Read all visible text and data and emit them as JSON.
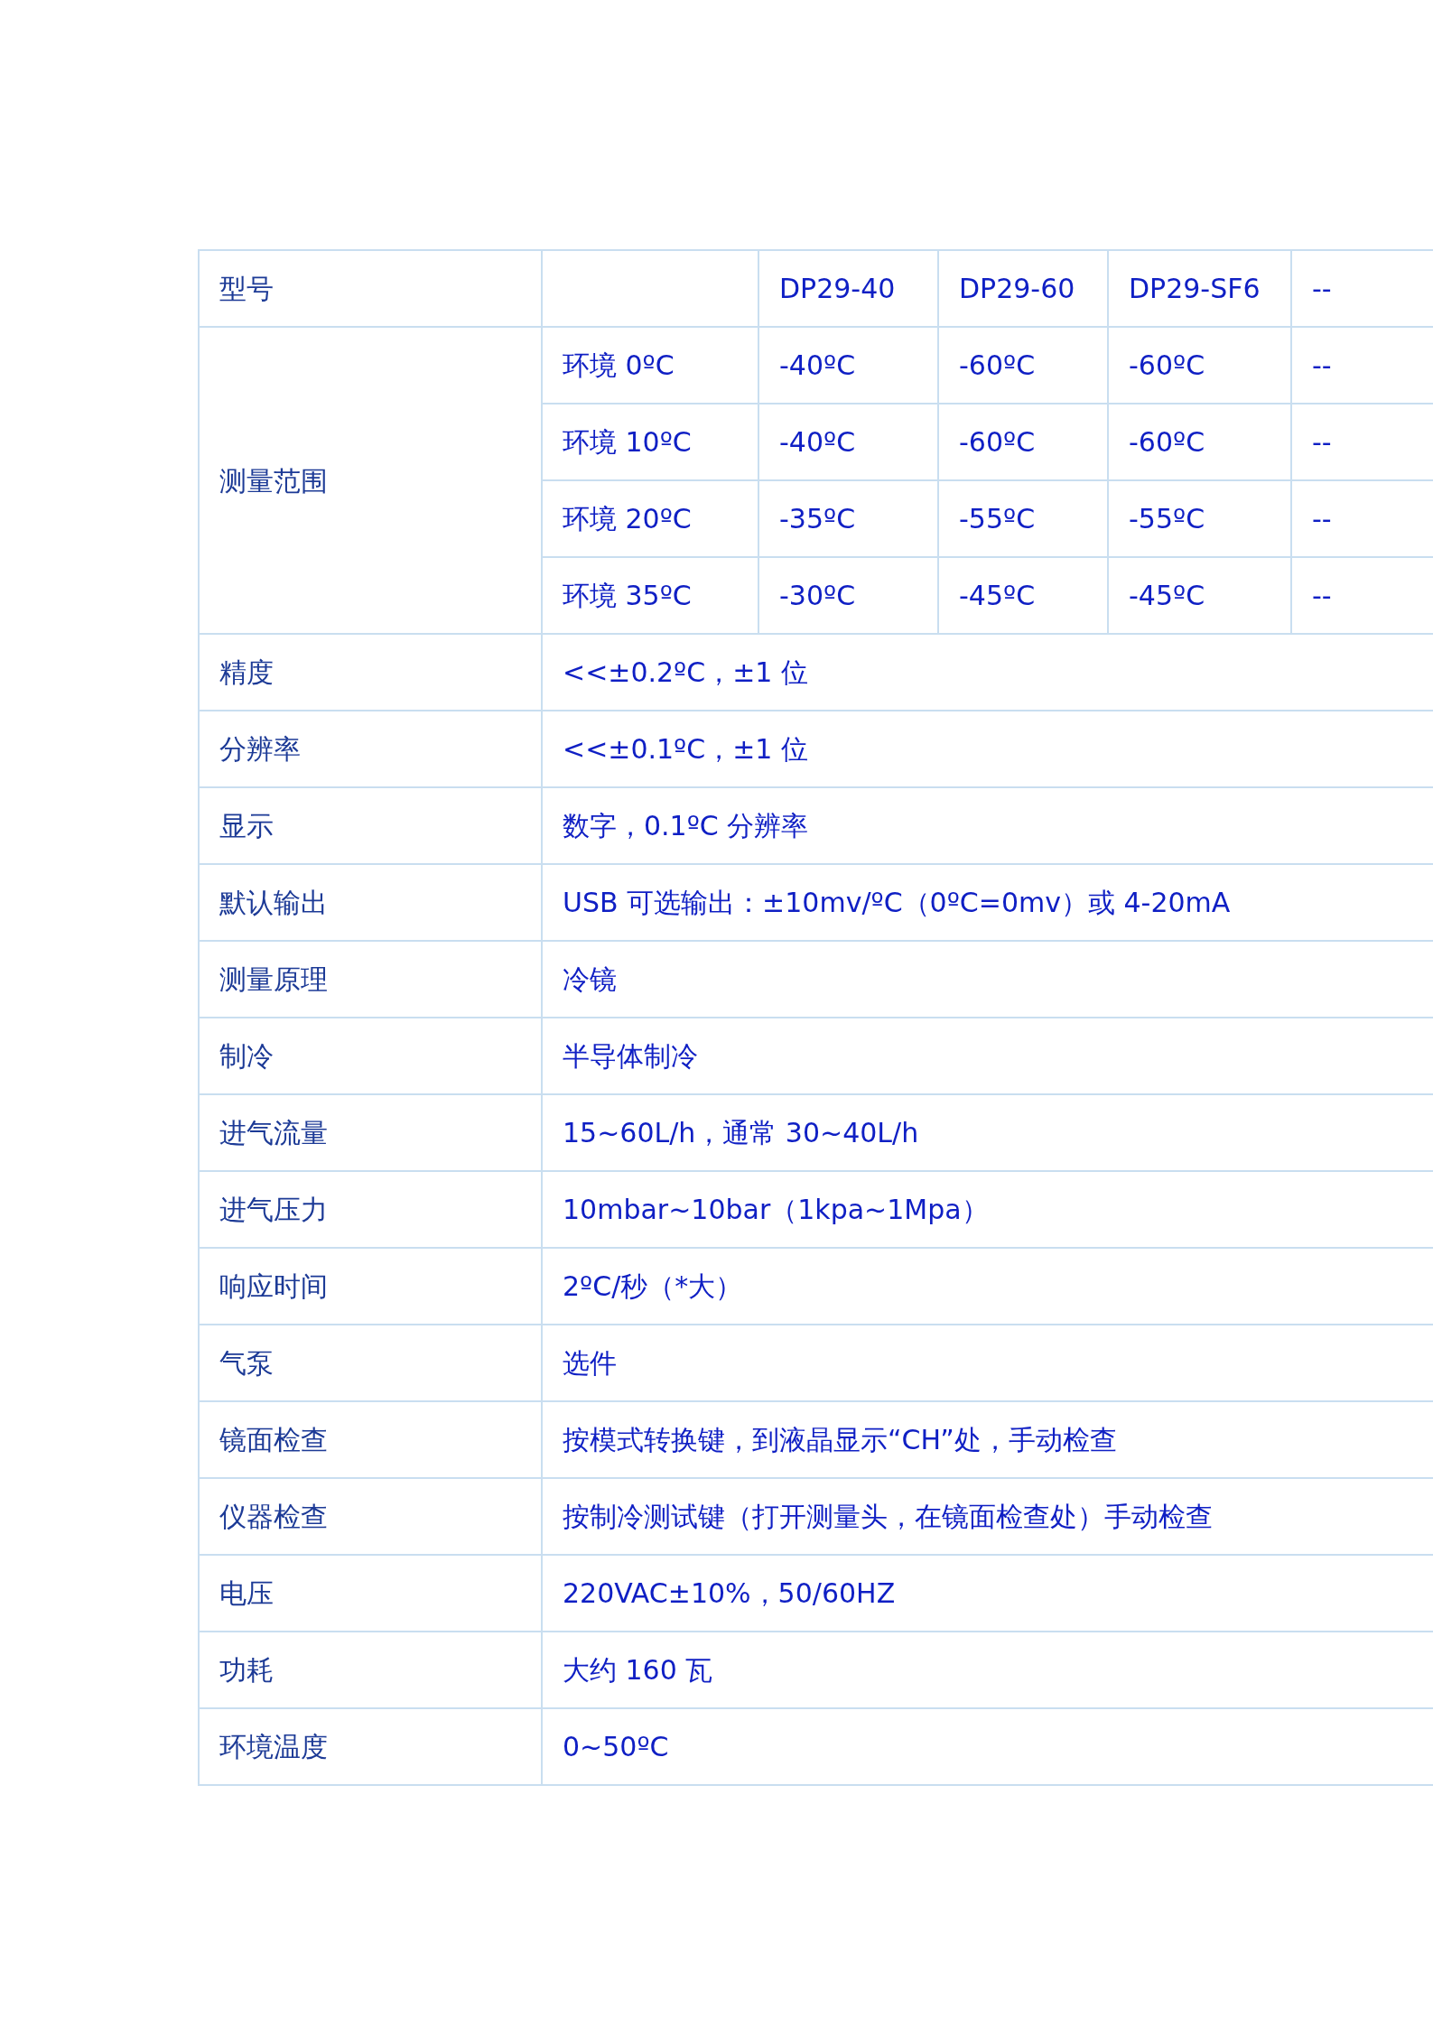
{
  "header": {
    "label": "型号",
    "models": [
      "DP29-40",
      "DP29-60",
      "DP29-SF6",
      "--"
    ]
  },
  "measurement_range": {
    "label": "测量范围",
    "rows": [
      {
        "condition": "环境 0ºC",
        "values": [
          "-40ºC",
          "-60ºC",
          "-60ºC",
          "--"
        ]
      },
      {
        "condition": "环境 10ºC",
        "values": [
          "-40ºC",
          "-60ºC",
          "-60ºC",
          "--"
        ]
      },
      {
        "condition": "环境 20ºC",
        "values": [
          "-35ºC",
          "-55ºC",
          "-55ºC",
          "--"
        ]
      },
      {
        "condition": "环境 35ºC",
        "values": [
          "-30ºC",
          "-45ºC",
          "-45ºC",
          "--"
        ]
      }
    ]
  },
  "specs": [
    {
      "label": "精度",
      "value": "<<±0.2ºC，±1 位"
    },
    {
      "label": "分辨率",
      "value": "<<±0.1ºC，±1 位"
    },
    {
      "label": "显示",
      "value": "数字，0.1ºC 分辨率"
    },
    {
      "label": "默认输出",
      "value": "USB 可选输出：±10mv/ºC（0ºC=0mv）或  4-20mA"
    },
    {
      "label": "测量原理",
      "value": "冷镜"
    },
    {
      "label": "制冷",
      "value": "半导体制冷"
    },
    {
      "label": "进气流量",
      "value": "15~60L/h，通常 30~40L/h"
    },
    {
      "label": "进气压力",
      "value": "10mbar~10bar（1kpa~1Mpa）"
    },
    {
      "label": "响应时间",
      "value": "2ºC/秒（*大）"
    },
    {
      "label": "气泵",
      "value": "选件"
    },
    {
      "label": "镜面检查",
      "value": "按模式转换键，到液晶显示“CH”处，手动检查"
    },
    {
      "label": "仪器检查",
      "value": "按制冷测试键（打开测量头，在镜面检查处）手动检查"
    },
    {
      "label": "电压",
      "value": "220VAC±10%，50/60HZ"
    },
    {
      "label": "功耗",
      "value": "大约 160 瓦"
    },
    {
      "label": "环境温度",
      "value": "0~50ºC"
    }
  ]
}
